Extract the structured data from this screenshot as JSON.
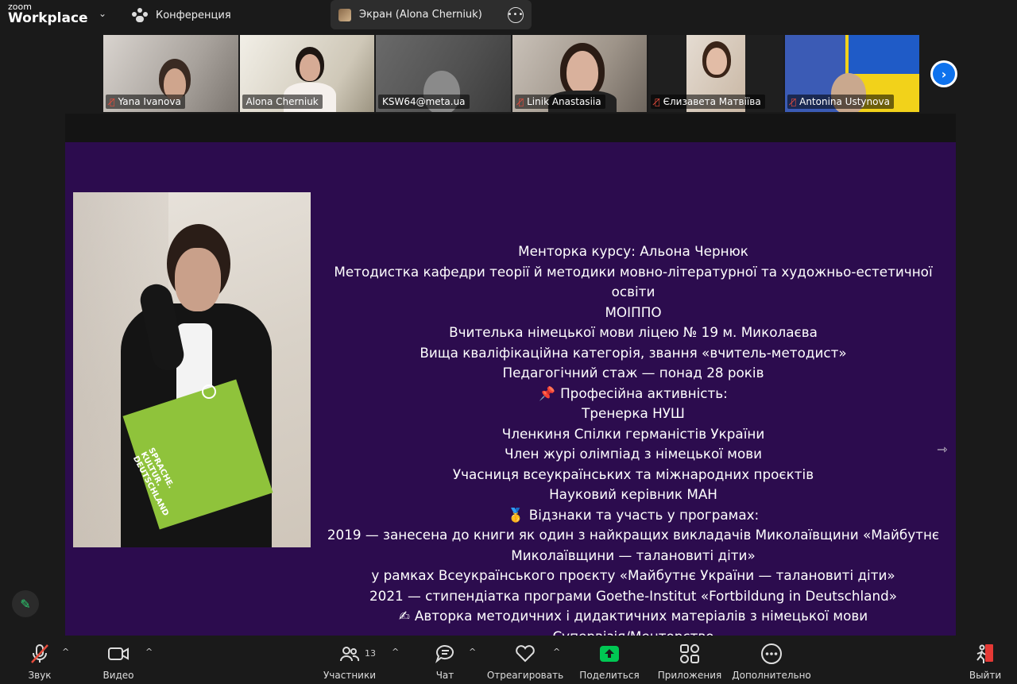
{
  "app": {
    "logo_small": "zoom",
    "logo_big": "Workplace",
    "meeting_label": "Конференция"
  },
  "share_pill": {
    "label": "Экран (Alona Cherniuk)"
  },
  "participants": [
    {
      "name": "Yana Ivanova",
      "muted": true
    },
    {
      "name": "Alona Cherniuk",
      "muted": false
    },
    {
      "name": "KSW64@meta.ua",
      "muted": false
    },
    {
      "name": "Linik Anastasiia",
      "muted": true
    },
    {
      "name": "Єлизавета Матвіїва",
      "muted": true
    },
    {
      "name": "Antonina Ustynova",
      "muted": true
    }
  ],
  "slide": {
    "photo_text_line1": "SPRACHE.",
    "photo_text_line2": "KULTUR.",
    "photo_text_line3": "DEUTSCHLAND",
    "lines": [
      "Менторка курсу: Альона Чернюк",
      "Методистка кафедри теорії й методики мовно-літературної та художньо-естетичної освіти",
      "МОІППО",
      "Вчителька німецької мови ліцею № 19 м. Миколаєва",
      "Вища кваліфікаційна категорія, звання «вчитель-методист»",
      "Педагогічний стаж — понад 28 років",
      "Професійна активність:",
      "Тренерка НУШ",
      "Членкиня Спілки германістів України",
      "Член журі олімпіад з німецької мови",
      "Учасниця всеукраїнських та міжнародних проєктів",
      "Науковий керівник МАН",
      "Відзнаки та участь у програмах:",
      "2019 — занесена до книги як один з найкращих викладачів Миколаївщини «Майбутнє",
      "Миколаївщини — талановиті діти»",
      "у рамках Всеукраїнського проєкту «Майбутнє України — талановиті діти»",
      "2021 — стипендіатка програми Goethe-Institut «Fortbildung in Deutschland»",
      "Авторка методичних і дидактичних матеріалів з німецької мови",
      "Супервізія/Менторство"
    ],
    "emoji_pin": "📌",
    "emoji_medal": "🥇",
    "emoji_hand": "✍"
  },
  "toolbar": {
    "audio": "Звук",
    "video": "Видео",
    "participants": "Участники",
    "participants_count": "13",
    "chat": "Чат",
    "react": "Отреагировать",
    "share": "Поделиться",
    "apps": "Приложения",
    "more": "Дополнительно",
    "leave": "Выйти"
  },
  "colors": {
    "accent_green": "#2ecc71",
    "zoom_blue": "#0e72ed",
    "slide_bg": "#2c0c4e",
    "share_green": "#00c853",
    "leave_red": "#e53935"
  }
}
